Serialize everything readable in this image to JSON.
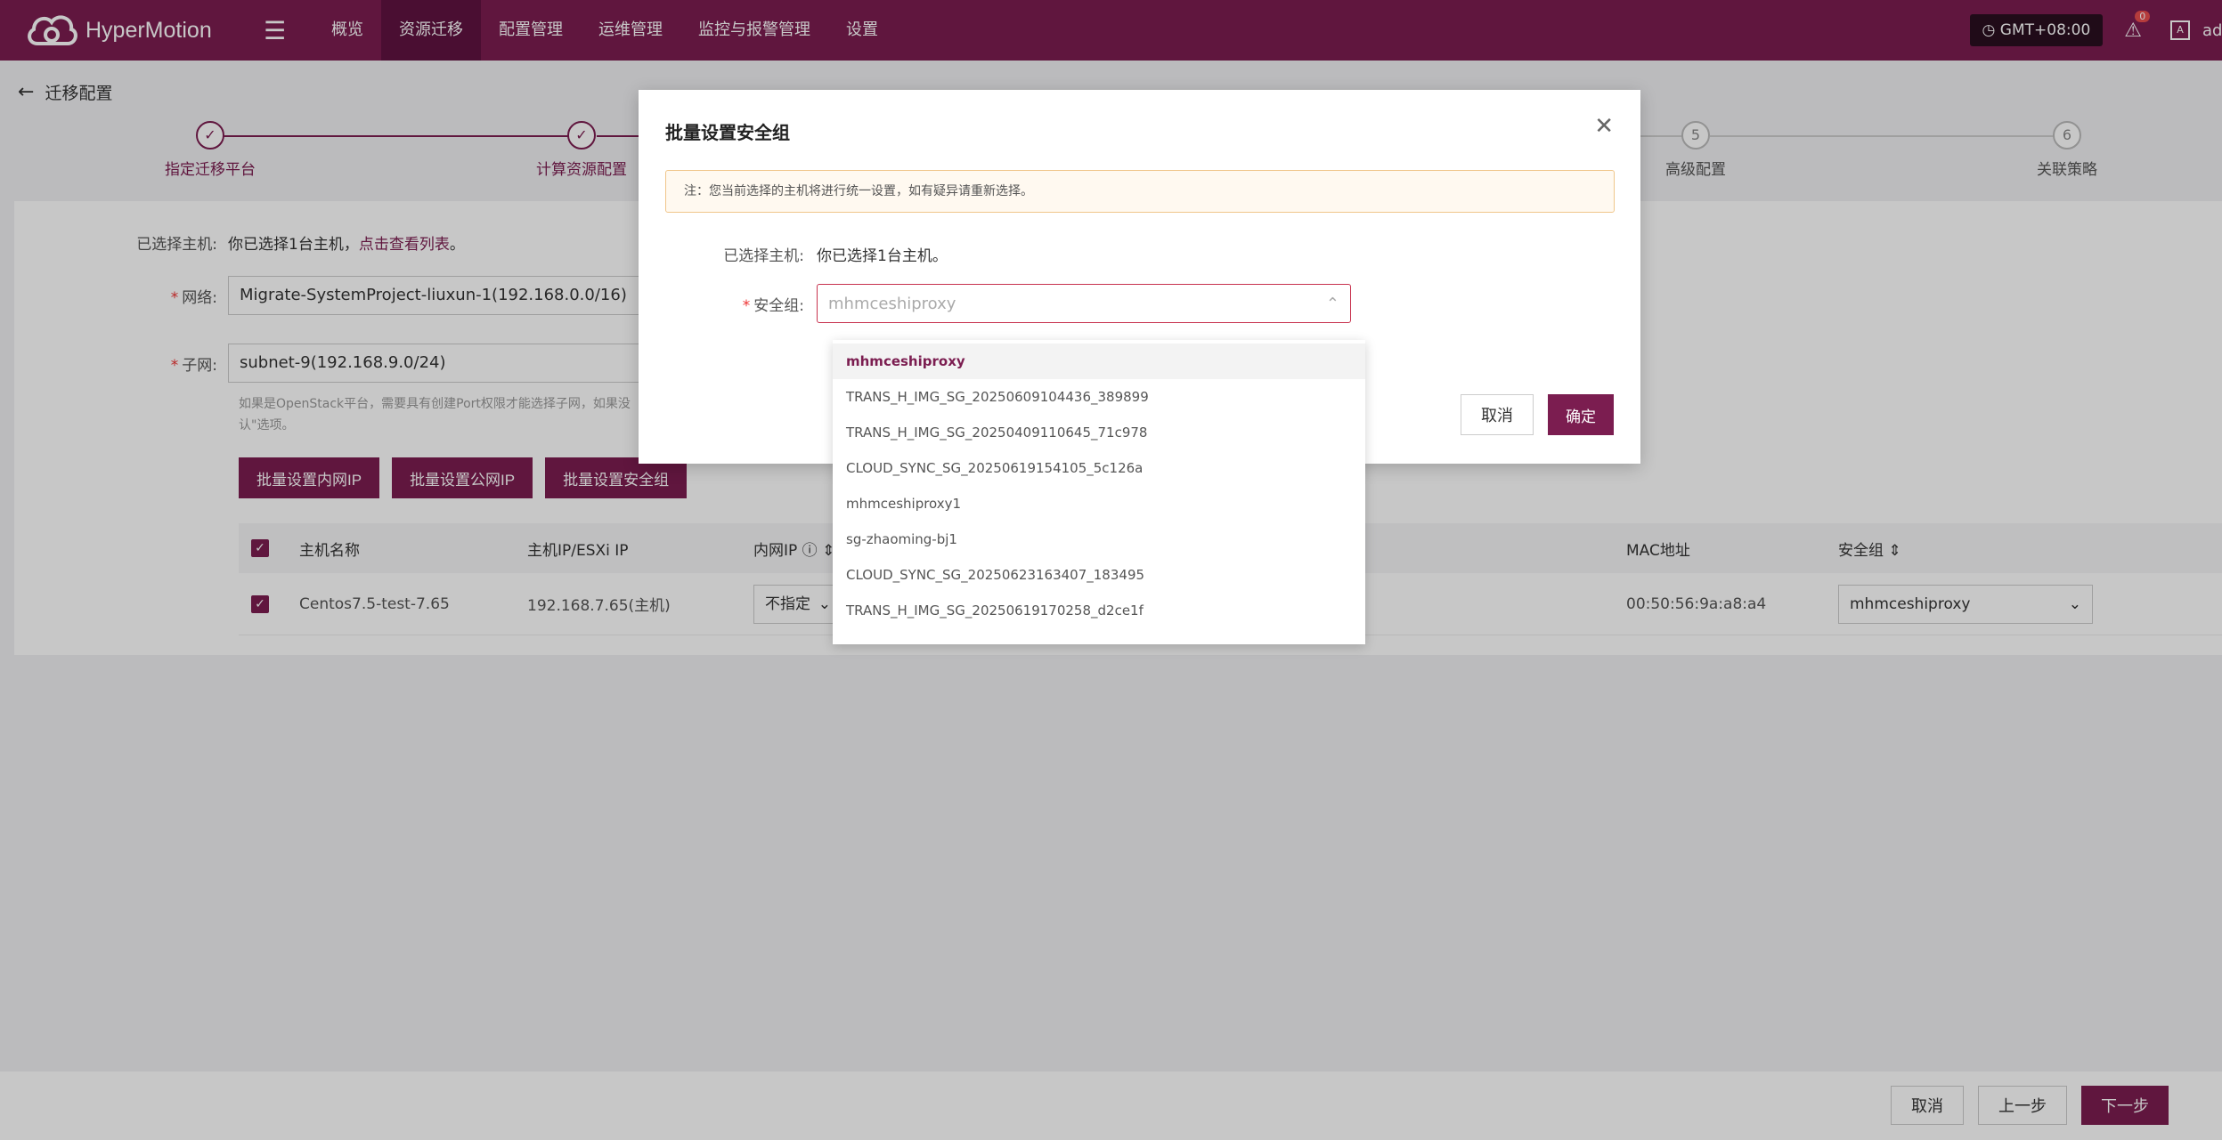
{
  "app": {
    "name": "HyperMotion"
  },
  "nav": [
    {
      "label": "概览"
    },
    {
      "label": "资源迁移",
      "active": true
    },
    {
      "label": "配置管理"
    },
    {
      "label": "运维管理"
    },
    {
      "label": "监控与报警管理"
    },
    {
      "label": "设置"
    }
  ],
  "topright": {
    "timezone": "GMT+08:00",
    "alert_count": "0",
    "lang": "A",
    "user": "ad"
  },
  "page": {
    "title": "迁移配置"
  },
  "steps": [
    {
      "label": "指定迁移平台",
      "state": "done"
    },
    {
      "label": "计算资源配置",
      "state": "done"
    },
    {
      "label": "高级配置",
      "num": "5",
      "state": "todo"
    },
    {
      "label": "关联策略",
      "num": "6",
      "state": "todo"
    }
  ],
  "form": {
    "selected_label": "已选择主机:",
    "selected_text": "你已选择1台主机，",
    "selected_link": "点击查看列表",
    "selected_end": "。",
    "network_label": "网络:",
    "network_value": "Migrate-SystemProject-liuxun-1(192.168.0.0/16)",
    "subnet_label": "子网:",
    "subnet_value": "subnet-9(192.168.9.0/24)",
    "hint": "如果是OpenStack平台，需要具有创建Port权限才能选择子网，如果没",
    "hint2": "认\"选项。"
  },
  "batch": {
    "btn_inner_ip": "批量设置内网IP",
    "btn_public_ip": "批量设置公网IP",
    "btn_sg": "批量设置安全组"
  },
  "table": {
    "headers": {
      "name": "主机名称",
      "ip": "主机IP/ESXi IP",
      "inner_ip": "内网IP",
      "mac": "MAC地址",
      "sg": "安全组"
    },
    "rows": [
      {
        "name": "Centos7.5-test-7.65",
        "ip": "192.168.7.65(主机)",
        "inner_ip": "不指定",
        "mac": "00:50:56:9a:a8:a4",
        "sg": "mhmceshiproxy"
      }
    ]
  },
  "footer": {
    "cancel": "取消",
    "prev": "上一步",
    "next": "下一步"
  },
  "modal": {
    "title": "批量设置安全组",
    "notice": "注：您当前选择的主机将进行统一设置，如有疑异请重新选择。",
    "selected_label": "已选择主机:",
    "selected_value": "你已选择1台主机。",
    "sg_label": "安全组:",
    "sg_placeholder": "mhmceshiproxy",
    "cancel": "取消",
    "confirm": "确定"
  },
  "dropdown": {
    "options": [
      "mhmceshiproxy",
      "TRANS_H_IMG_SG_20250609104436_389899",
      "TRANS_H_IMG_SG_20250409110645_71c978",
      "CLOUD_SYNC_SG_20250619154105_5c126a",
      "mhmceshiproxy1",
      "sg-zhaoming-bj1",
      "CLOUD_SYNC_SG_20250623163407_183495",
      "TRANS_H_IMG_SG_20250619170258_d2ce1f"
    ]
  },
  "colors": {
    "brand": "#7b1d50",
    "brand_dark": "#5f1340",
    "danger": "#e33"
  }
}
